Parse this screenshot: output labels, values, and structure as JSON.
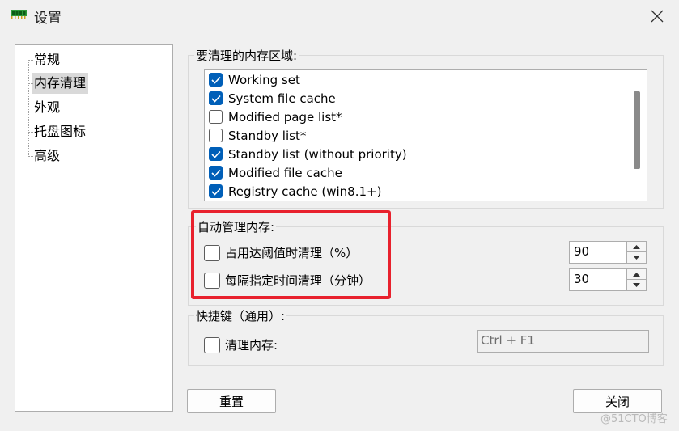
{
  "window": {
    "title": "设置",
    "close_icon": "close-icon",
    "app_icon": "memory-chip-icon"
  },
  "nav": {
    "items": [
      {
        "label": "常规",
        "selected": false
      },
      {
        "label": "内存清理",
        "selected": true
      },
      {
        "label": "外观",
        "selected": false
      },
      {
        "label": "托盘图标",
        "selected": false
      },
      {
        "label": "高级",
        "selected": false
      }
    ]
  },
  "regions": {
    "label": "要清理的内存区域:",
    "items": [
      {
        "label": "Working set",
        "checked": true
      },
      {
        "label": "System file cache",
        "checked": true
      },
      {
        "label": "Modified page list*",
        "checked": false
      },
      {
        "label": "Standby list*",
        "checked": false
      },
      {
        "label": "Standby list (without priority)",
        "checked": true
      },
      {
        "label": "Modified file cache",
        "checked": true
      },
      {
        "label": "Registry cache (win8.1+)",
        "checked": true
      }
    ]
  },
  "auto": {
    "label": "自动管理内存:",
    "threshold": {
      "label": "占用达阈值时清理（%）",
      "checked": false,
      "value": "90"
    },
    "interval": {
      "label": "每隔指定时间清理（分钟）",
      "checked": false,
      "value": "30"
    }
  },
  "hotkey": {
    "label": "快捷键（通用）:",
    "clean": {
      "label": "清理内存:",
      "checked": false
    },
    "value": "Ctrl + F1"
  },
  "buttons": {
    "reset": "重置",
    "close": "关闭"
  },
  "watermark": "@51CTO博客",
  "colors": {
    "accent": "#005fb8",
    "highlight": "#e8212d"
  }
}
